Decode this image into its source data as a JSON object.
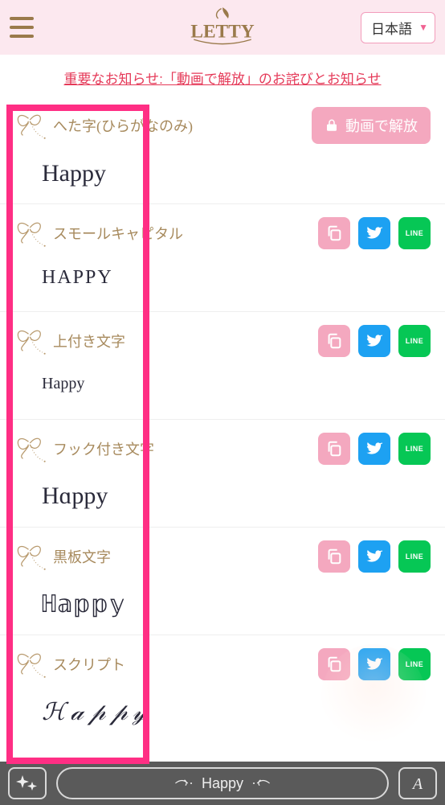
{
  "header": {
    "language_label": "日本語"
  },
  "notice": {
    "text": "重要なお知らせ:「動画で解放」のお詫びとお知らせ"
  },
  "unlock_button_label": "動画で解放",
  "fonts": [
    {
      "name": "へた字(ひらがなのみ)",
      "sample": "Happy",
      "locked": true,
      "style_class": "f-heta"
    },
    {
      "name": "スモールキャピタル",
      "sample": "HAPPY",
      "locked": false,
      "style_class": "f-small"
    },
    {
      "name": "上付き文字",
      "sample": "Happy",
      "locked": false,
      "style_class": "f-super"
    },
    {
      "name": "フック付き文字",
      "sample": "Hɑppy",
      "locked": false,
      "style_class": "f-hook"
    },
    {
      "name": "黒板文字",
      "sample": "ℍ𝕒𝕡𝕡𝕪",
      "locked": false,
      "style_class": "f-black"
    },
    {
      "name": "スクリプト",
      "sample": "ℋ𝒶𝓅𝓅𝓎",
      "locked": false,
      "style_class": "f-script"
    }
  ],
  "bottombar": {
    "input_text": "Happy"
  },
  "share_labels": {
    "line": "LINE"
  },
  "colors": {
    "header_bg": "#fce8ef",
    "brand_gold": "#9a7a4b",
    "accent_pink": "#f4a8bf",
    "notice_red": "#e53958",
    "twitter": "#1da1f2",
    "line": "#06c755",
    "highlight": "#ff2e84",
    "bottombar": "#5a5a5a"
  }
}
